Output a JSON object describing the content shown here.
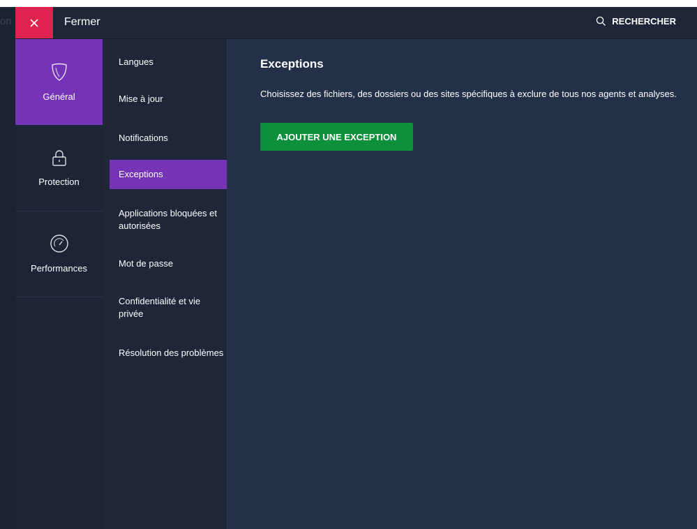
{
  "background_text": "on",
  "topbar": {
    "close_label": "Fermer",
    "search_label": "RECHERCHER"
  },
  "leftnav": {
    "items": [
      {
        "label": "Général",
        "icon": "shield-icon",
        "active": true
      },
      {
        "label": "Protection",
        "icon": "lock-icon",
        "active": false
      },
      {
        "label": "Performances",
        "icon": "speedometer-icon",
        "active": false
      }
    ]
  },
  "subnav": {
    "items": [
      {
        "label": "Langues"
      },
      {
        "label": "Mise à jour"
      },
      {
        "label": "Notifications"
      },
      {
        "label": "Exceptions",
        "active": true
      },
      {
        "label": "Applications bloquées et autorisées"
      },
      {
        "label": "Mot de passe"
      },
      {
        "label": "Confidentialité et vie privée"
      },
      {
        "label": "Résolution des problèmes"
      }
    ]
  },
  "content": {
    "title": "Exceptions",
    "description": "Choisissez des fichiers, des dossiers ou des sites spécifiques à exclure de tous nos agents et analyses.",
    "button_label": "AJOUTER UNE EXCEPTION"
  },
  "colors": {
    "accent_purple": "#7533b8",
    "close_red": "#e0224e",
    "button_green": "#0d8f3b",
    "panel_bg": "#243047"
  }
}
